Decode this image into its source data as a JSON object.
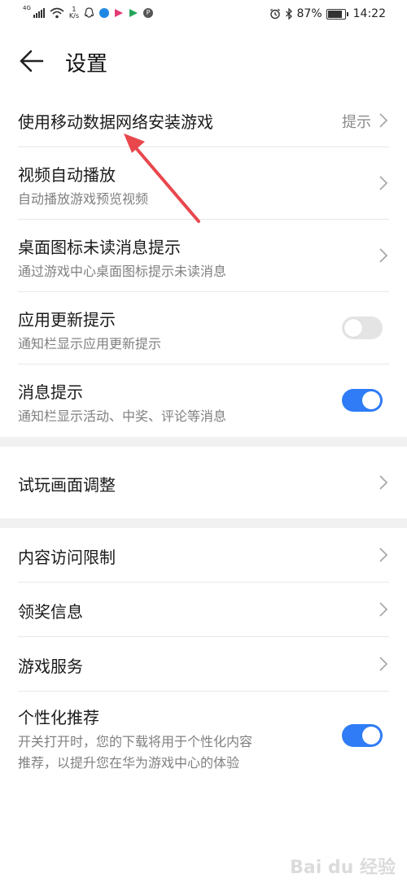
{
  "status_bar": {
    "network": "4G",
    "speed_value": "1",
    "speed_unit": "K/s",
    "battery": "87%",
    "time": "14:22",
    "icons": [
      "signal-icon",
      "wifi-icon",
      "qq-icon",
      "browser-icon",
      "video-icon",
      "play-icon",
      "p-icon",
      "alarm-icon",
      "bluetooth-icon",
      "battery-icon"
    ]
  },
  "header": {
    "title": "设置",
    "back_icon": "back-arrow-icon"
  },
  "settings": [
    {
      "title": "使用移动数据网络安装游戏",
      "hint": "提示"
    },
    {
      "title": "视频自动播放",
      "subtitle": "自动播放游戏预览视频"
    },
    {
      "title": "桌面图标未读消息提示",
      "subtitle": "通过游戏中心桌面图标提示未读消息"
    },
    {
      "title": "应用更新提示",
      "subtitle": "通知栏显示应用更新提示",
      "toggle": "off"
    },
    {
      "title": "消息提示",
      "subtitle": "通知栏显示活动、中奖、评论等消息",
      "toggle": "on"
    },
    {
      "title": "试玩画面调整"
    },
    {
      "title": "内容访问限制"
    },
    {
      "title": "领奖信息"
    },
    {
      "title": "游戏服务"
    },
    {
      "title": "个性化推荐",
      "subtitle_line1": "开关打开时，您的下载将用于个性化内容",
      "subtitle_line2": "推荐，以提升您在华为游戏中心的体验",
      "toggle": "on"
    }
  ],
  "colors": {
    "toggle_on": "#2f7cf6",
    "toggle_off": "#e4e4e4",
    "annotation_arrow": "#e8474c",
    "section_gap": "#f1f1f1"
  },
  "watermark": "Bai du 经验"
}
